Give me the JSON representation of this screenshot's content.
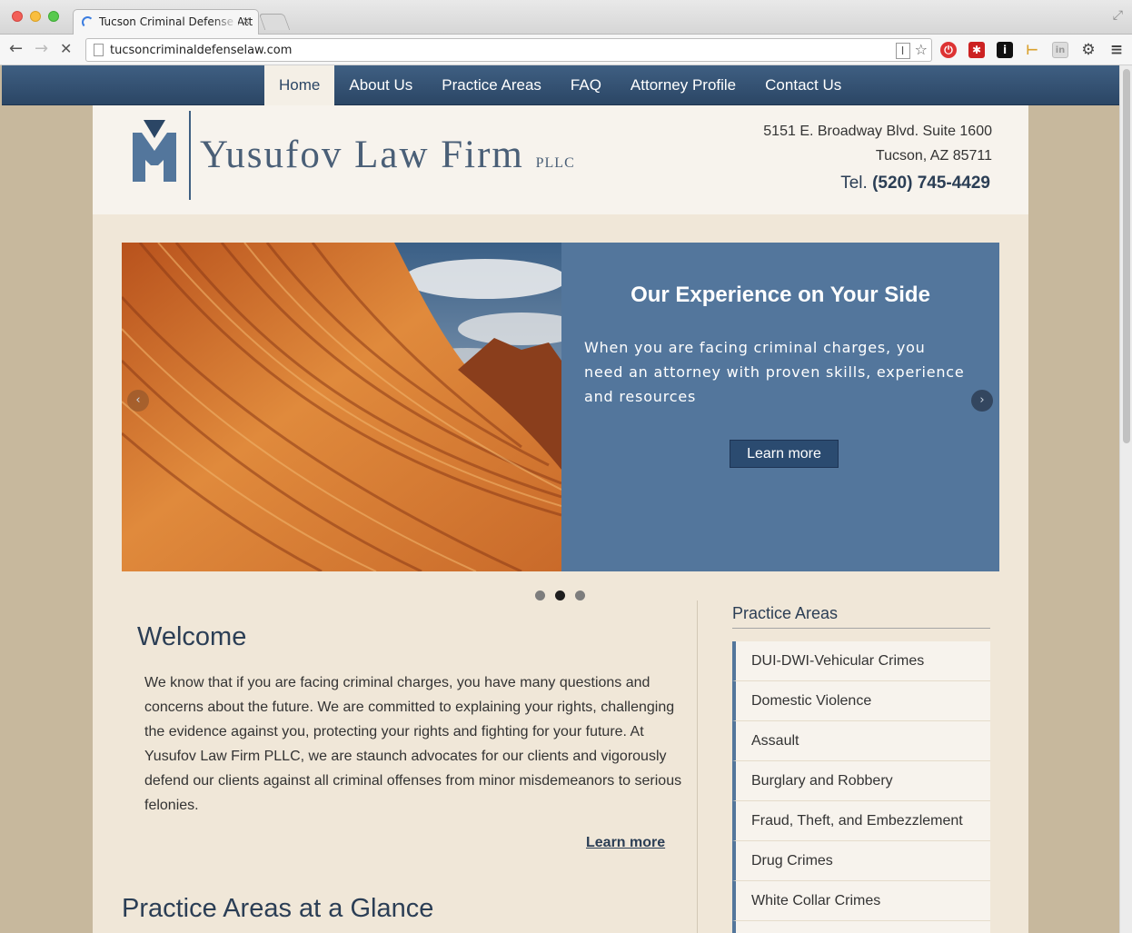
{
  "browser": {
    "tab_title": "Tucson Criminal Defense Att",
    "tab_close": "×",
    "url": "tucsoncriminaldefenselaw.com"
  },
  "nav": {
    "items": [
      "Home",
      "About Us",
      "Practice Areas",
      "FAQ",
      "Attorney Profile",
      "Contact Us"
    ],
    "active": "Home"
  },
  "header": {
    "firm_name": "Yusufov Law Firm",
    "firm_suffix": "PLLC",
    "address_line1": "5151 E. Broadway Blvd. Suite 1600",
    "address_line2": "Tucson, AZ 85711",
    "tel_label": "Tel.",
    "tel_number": "(520) 745-4429"
  },
  "slider": {
    "title": "Our Experience on Your Side",
    "text": "When you are facing criminal charges, you need an attorney with proven skills, experience and resources",
    "button": "Learn more",
    "prev_icon": "chevron-left-icon",
    "next_icon": "chevron-right-icon",
    "dots": 3,
    "active_dot": 2
  },
  "welcome": {
    "heading": "Welcome",
    "body": "We know that if you are facing criminal charges, you have many questions and concerns about the future. We are committed to explaining your rights, challenging the evidence against you, protecting your rights and fighting for your future. At Yusufov Law Firm PLLC, we are staunch advocates for our clients and vigorously defend our clients against all criminal offenses from minor misdemeanors to serious felonies.",
    "more": "Learn more"
  },
  "glance": {
    "heading": "Practice Areas at a Glance"
  },
  "sidebar": {
    "heading": "Practice Areas",
    "items": [
      "DUI-DWI-Vehicular Crimes",
      "Domestic Violence",
      "Assault",
      "Burglary and Robbery",
      "Fraud, Theft, and Embezzlement",
      "Drug Crimes",
      "White Collar Crimes"
    ]
  },
  "colors": {
    "brand_navy": "#2b4665",
    "slide_panel": "#53769c",
    "page_bg": "#f0e7d8"
  }
}
